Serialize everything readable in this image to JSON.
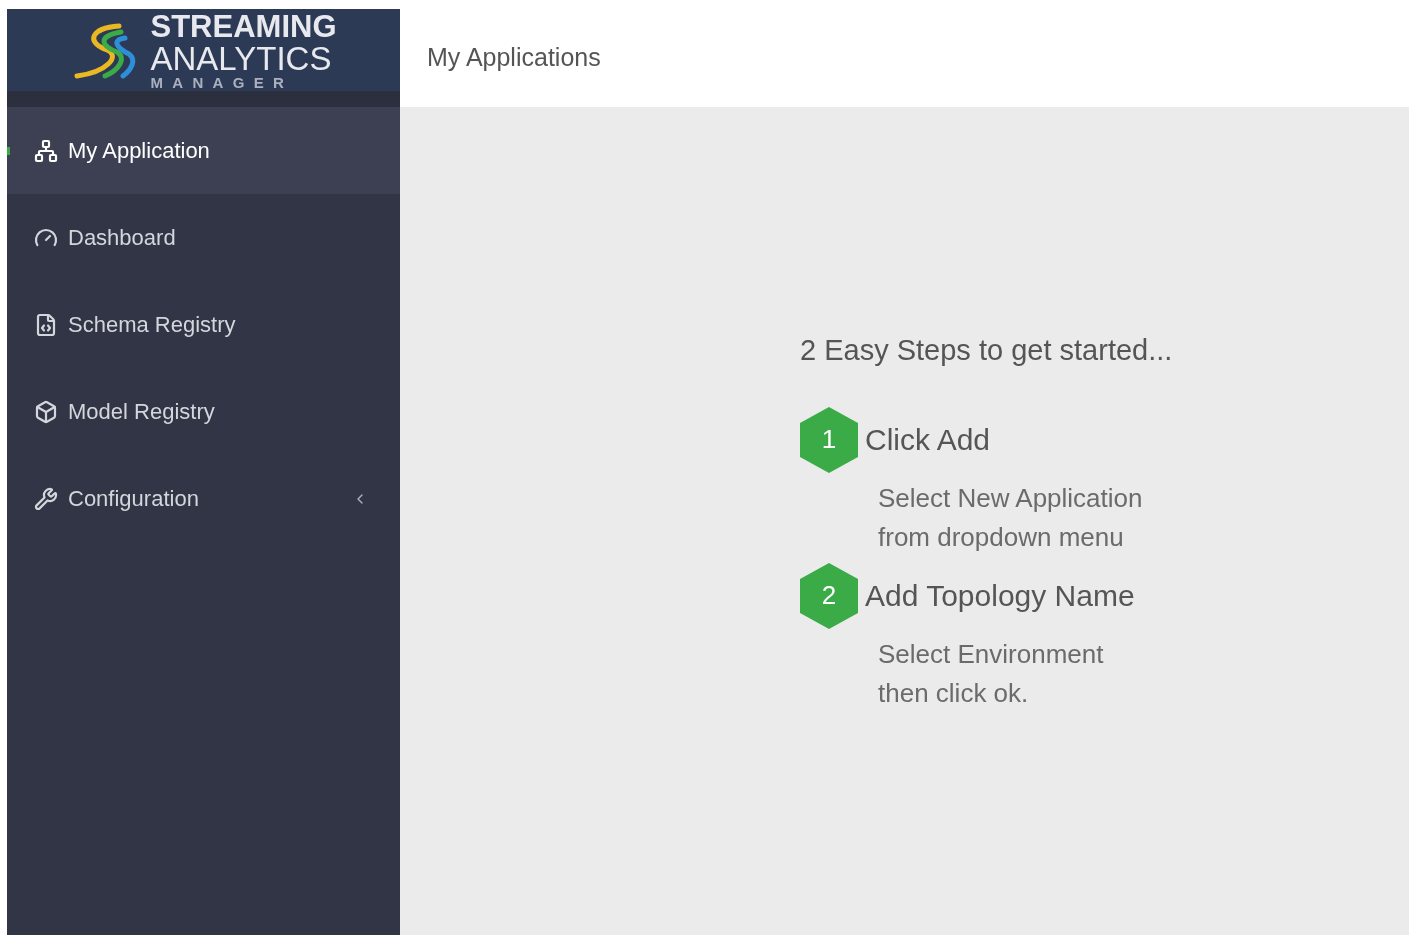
{
  "logo": {
    "line_1": "STREAMING",
    "line_2": "ANALYTICS",
    "line_3": "MANAGER"
  },
  "sidebar": {
    "items": [
      {
        "label": "My Application",
        "selected": true
      },
      {
        "label": "Dashboard",
        "selected": false
      },
      {
        "label": "Schema Registry",
        "selected": false
      },
      {
        "label": "Model Registry",
        "selected": false
      },
      {
        "label": "Configuration",
        "selected": false,
        "expandable": true
      }
    ]
  },
  "header": {
    "title": "My Applications"
  },
  "intro": {
    "heading": "2 Easy Steps to get started...",
    "steps": [
      {
        "number": "1",
        "title": "Click Add",
        "lines": [
          "Select New Application",
          "from dropdown menu"
        ]
      },
      {
        "number": "2",
        "title": "Add Topology Name",
        "lines": [
          "Select Environment",
          "then click ok."
        ]
      }
    ]
  }
}
